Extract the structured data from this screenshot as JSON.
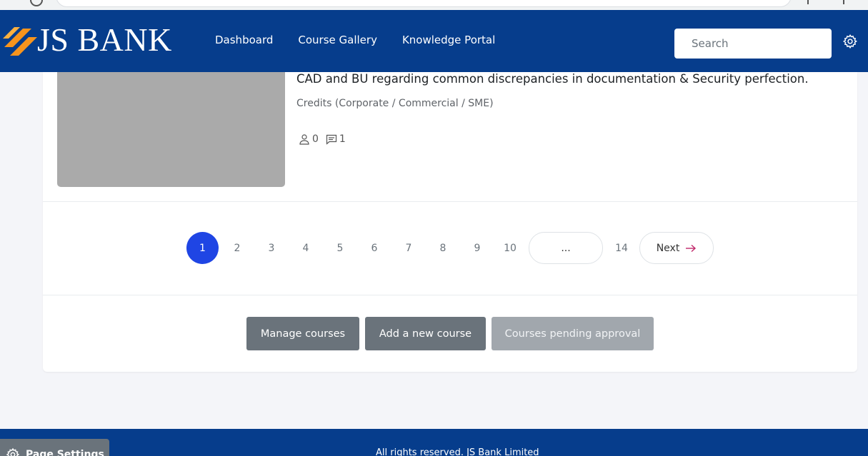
{
  "navbar": {
    "logo_text": "JS BANK",
    "links": [
      "Dashboard",
      "Course Gallery",
      "Knowledge Portal"
    ],
    "search_placeholder": "Search",
    "colors": {
      "navbar_bg": "#063d8c",
      "logo_orange": "#f7941d"
    }
  },
  "course": {
    "title": "CAD and BU regarding common discrepancies in documentation & Security perfection.",
    "category": "Credits (Corporate / Commercial / SME)",
    "participants": "0",
    "comments": "1"
  },
  "pagination": {
    "pages": [
      "1",
      "2",
      "3",
      "4",
      "5",
      "6",
      "7",
      "8",
      "9",
      "10"
    ],
    "active_page": "1",
    "ellipsis": "...",
    "last_page": "14",
    "next_label": "Next",
    "active_color": "#1f45e4"
  },
  "actions": {
    "manage_courses": "Manage courses",
    "add_new_course": "Add a new course",
    "courses_pending_approval": "Courses pending approval"
  },
  "footer": {
    "text": "All rights reserved. JS Bank Limited"
  },
  "page_settings": {
    "label": "Page Settings"
  }
}
